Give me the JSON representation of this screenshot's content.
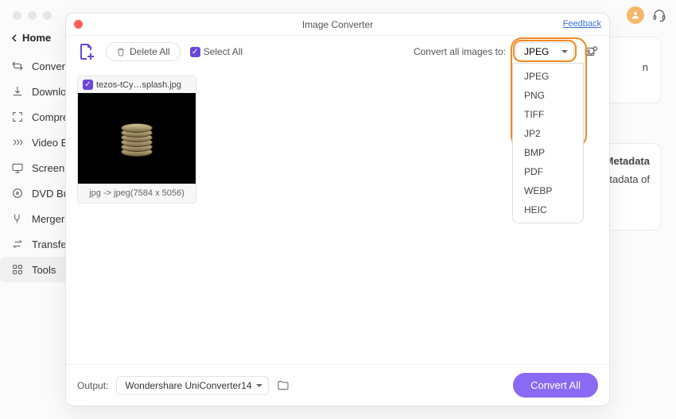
{
  "sidebar": {
    "back": "Home",
    "items": [
      {
        "icon": "convert",
        "label": "Converter"
      },
      {
        "icon": "download",
        "label": "Downloader"
      },
      {
        "icon": "compress",
        "label": "Compressor"
      },
      {
        "icon": "video",
        "label": "Video Editor"
      },
      {
        "icon": "screen",
        "label": "Screen Recorder"
      },
      {
        "icon": "dvd",
        "label": "DVD Burner"
      },
      {
        "icon": "merge",
        "label": "Merger"
      },
      {
        "icon": "transfer",
        "label": "Transfer"
      },
      {
        "icon": "tools",
        "label": "Tools"
      }
    ]
  },
  "obscured": {
    "header": "Metadata",
    "line1": "Fix metadata of",
    "line2": "n"
  },
  "modal": {
    "title": "Image Converter",
    "feedback": "Feedback",
    "delete_all": "Delete All",
    "select_all": "Select All",
    "convert_label": "Convert all images to:",
    "selected_format": "JPEG",
    "formats": [
      "JPEG",
      "PNG",
      "TIFF",
      "JP2",
      "BMP",
      "PDF",
      "WEBP",
      "HEIC"
    ],
    "thumb": {
      "filename": "tezos-tCy…splash.jpg",
      "caption": "jpg -> jpeg(7584 x 5056)"
    },
    "footer": {
      "label": "Output:",
      "location": "Wondershare UniConverter14",
      "convert": "Convert All"
    }
  }
}
